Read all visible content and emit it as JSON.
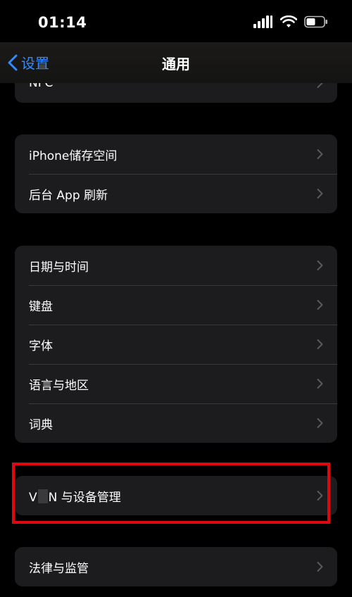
{
  "status": {
    "time": "01:14"
  },
  "nav": {
    "back_label": "设置",
    "title": "通用"
  },
  "groups": {
    "nfc": {
      "label": "NFC"
    },
    "storage": {
      "items": [
        {
          "label": "iPhone储存空间"
        },
        {
          "label": "后台 App 刷新"
        }
      ]
    },
    "locale": {
      "items": [
        {
          "label": "日期与时间"
        },
        {
          "label": "键盘"
        },
        {
          "label": "字体"
        },
        {
          "label": "语言与地区"
        },
        {
          "label": "词典"
        }
      ]
    },
    "vpn": {
      "label_prefix": "V",
      "label_suffix": "N 与设备管理"
    },
    "legal": {
      "label": "法律与监管"
    }
  },
  "colors": {
    "accent": "#2f8bff",
    "highlight_border": "#e0070e",
    "cell_bg": "#1c1c1e"
  }
}
